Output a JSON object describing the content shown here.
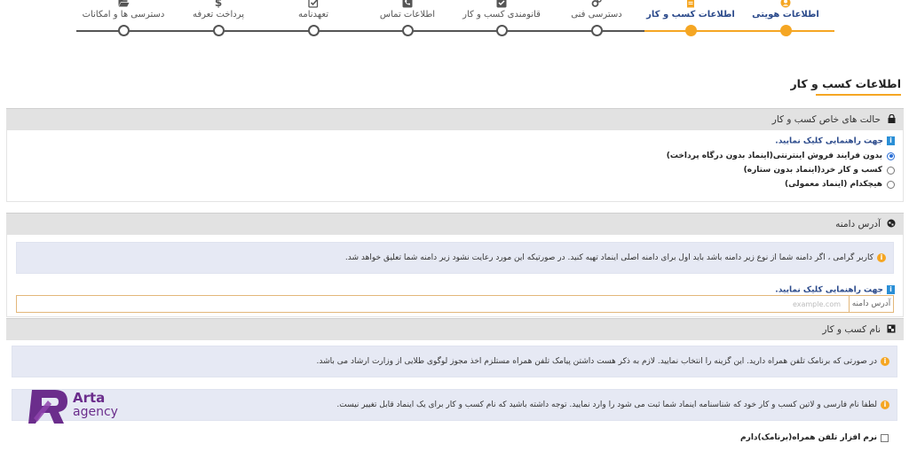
{
  "stepper": {
    "steps": [
      {
        "label": "اطلاعات هویتی",
        "icon": "user-icon",
        "active": true
      },
      {
        "label": "اطلاعات کسب و کار",
        "icon": "document-icon",
        "active": true
      },
      {
        "label": "دسترسی فنی",
        "icon": "gears-icon",
        "active": false
      },
      {
        "label": "قانومندی کسب و کار",
        "icon": "checkbox-icon",
        "active": false
      },
      {
        "label": "اطلاعات تماس",
        "icon": "phone-icon",
        "active": false
      },
      {
        "label": "تعهدنامه",
        "icon": "check-square-icon",
        "active": false
      },
      {
        "label": "پرداخت تعرفه",
        "icon": "dollar-icon",
        "active": false
      },
      {
        "label": "دسترسی ها و امکانات",
        "icon": "folder-open-icon",
        "active": false
      }
    ],
    "active_color": "#f5a623"
  },
  "page": {
    "title": "اطلاعات کسب و کار"
  },
  "special_state": {
    "header": "حالت های خاص کسب و کار",
    "header_icon": "lock-icon",
    "help_link": "جهت راهنمایی کلیک نمایید.",
    "options": [
      {
        "label": "بدون فرایند فروش اینترنتی(اینماد بدون درگاه پرداخت)",
        "selected": true
      },
      {
        "label": "کسب و کار خرد(اینماد بدون ستاره)",
        "selected": false
      },
      {
        "label": "هیچکدام (اینماد معمولی)",
        "selected": false
      }
    ]
  },
  "domain": {
    "header": "آدرس دامنه",
    "header_icon": "globe-icon",
    "notice": "کاربر گرامی ، اگر دامنه شما از نوع زیر دامنه باشد باید اول برای دامنه اصلی اینماد تهیه کنید. در صورتیکه این مورد رعایت نشود زیر دامنه شما تعلیق خواهد شد.",
    "help_link": "جهت راهنمایی کلیک نمایید.",
    "addon_label": "آدرس دامنه",
    "input_placeholder": "example.com",
    "input_value": ""
  },
  "business_name": {
    "header": "نام کسب و کار",
    "header_icon": "puzzle-icon",
    "notice_app": "در صورتی که برنامک تلفن همراه دارید. این گزینه را انتخاب نمایید. لازم به ذکر هست داشتن پیامک تلفن همراه مستلزم اخذ مجوز لوگوی طلایی از وزارت ارشاد می باشد.",
    "notice_name": "لطفا نام فارسی و لاتین کسب و کار خود که شناسنامه اینماد شما ثبت می شود را وارد نمایید. توجه داشته باشید که نام کسب و کار برای یک اینماد قابل تغییر نیست.",
    "app_checkbox_label": "نرم افزار تلفن همراه(برنامک)دارم",
    "app_checkbox_checked": false
  },
  "watermark": {
    "line1": "Arta",
    "line2": "agency",
    "color": "#6b2d8c"
  }
}
